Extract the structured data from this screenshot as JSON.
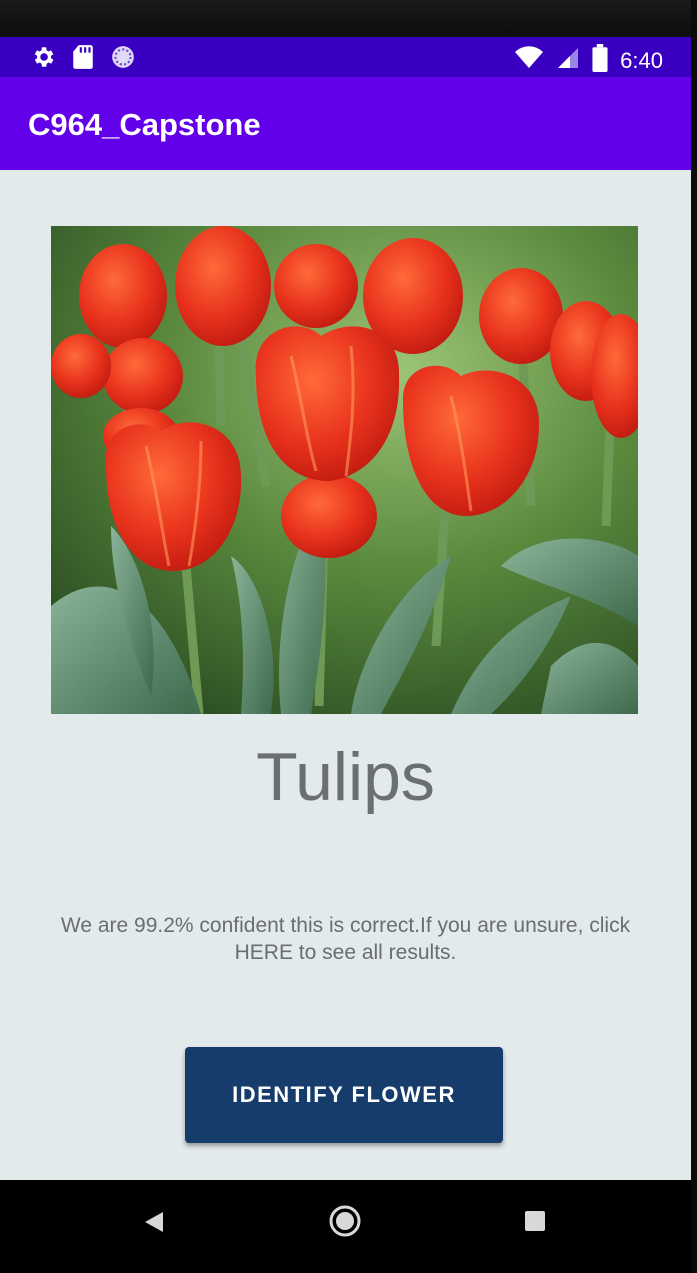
{
  "status_bar": {
    "time": "6:40",
    "left_icons": [
      "gear-icon",
      "sd-card-icon",
      "sync-circle-icon"
    ],
    "right_icons": [
      "wifi-icon",
      "cell-signal-icon",
      "battery-icon"
    ]
  },
  "app_bar": {
    "title": "C964_Capstone"
  },
  "main": {
    "image_subject": "red tulips",
    "flower_name": "Tulips",
    "confidence_message": "We are 99.2% confident this is correct.If you are unsure, click HERE to see all results.",
    "identify_button_label": "IDENTIFY FLOWER"
  },
  "nav_bar": {
    "buttons": [
      "back-icon",
      "home-icon",
      "recents-icon"
    ]
  },
  "colors": {
    "status_bar": "#3a00c2",
    "app_bar": "#6200ea",
    "background": "#e3eaec",
    "button": "#163c6c"
  }
}
